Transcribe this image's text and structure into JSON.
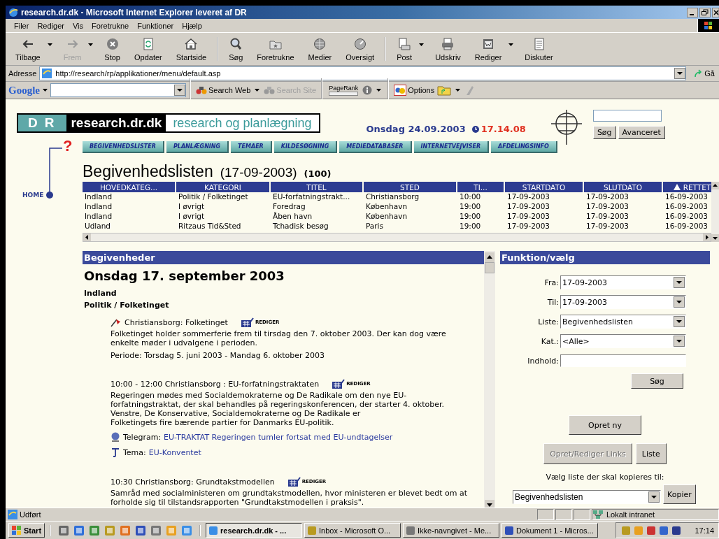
{
  "window": {
    "title": "research.dr.dk - Microsoft Internet Explorer leveret af DR"
  },
  "menu": [
    "Filer",
    "Rediger",
    "Vis",
    "Foretrukne",
    "Funktioner",
    "Hjælp"
  ],
  "toolbar": [
    {
      "label": "Tilbage",
      "disabled": false,
      "dropdown": true,
      "separator_before": false
    },
    {
      "label": "Frem",
      "disabled": true,
      "dropdown": true,
      "separator_before": false
    },
    {
      "label": "Stop",
      "disabled": false,
      "dropdown": false,
      "separator_before": false
    },
    {
      "label": "Opdater",
      "disabled": false,
      "dropdown": false,
      "separator_before": false
    },
    {
      "label": "Startside",
      "disabled": false,
      "dropdown": false,
      "separator_before": false
    },
    {
      "label": "Søg",
      "disabled": false,
      "dropdown": false,
      "separator_before": true
    },
    {
      "label": "Foretrukne",
      "disabled": false,
      "dropdown": false,
      "separator_before": false
    },
    {
      "label": "Medier",
      "disabled": false,
      "dropdown": false,
      "separator_before": false
    },
    {
      "label": "Oversigt",
      "disabled": false,
      "dropdown": false,
      "separator_before": false
    },
    {
      "label": "Post",
      "disabled": false,
      "dropdown": true,
      "separator_before": true
    },
    {
      "label": "Udskriv",
      "disabled": false,
      "dropdown": false,
      "separator_before": false
    },
    {
      "label": "Rediger",
      "disabled": false,
      "dropdown": true,
      "separator_before": false
    },
    {
      "label": "Diskuter",
      "disabled": false,
      "dropdown": false,
      "separator_before": false
    }
  ],
  "address": {
    "label": "Adresse",
    "url": "http://research/rp/applikationer/menu/default.asp",
    "go": "Gå"
  },
  "google_bar": {
    "logo": "Google",
    "search_web": "Search Web",
    "search_site": "Search Site",
    "pagerank": "PageRank",
    "options": "Options"
  },
  "site": {
    "logo_mark": "DR",
    "site_name": "research.dr.dk",
    "tagline": "research og planlægning",
    "date": "Onsdag 24.09.2003",
    "time": "17.14.08",
    "search_button": "Søg",
    "advanced_button": "Avanceret",
    "help_mark": "?",
    "home_link": "HOME"
  },
  "nav": [
    "BEGIVENHEDSLISTER",
    "PLANLÆGNING",
    "TEMAER",
    "KILDESØGNING",
    "MEDIEDATABASER",
    "INTERNETVEJVISER",
    "AFDELINGSINFO"
  ],
  "list": {
    "title": "Begivenhedslisten",
    "range": "(17-09-2003)",
    "count": "(100)",
    "columns": [
      {
        "label": "HOVEDKATEG...",
        "sorted": false
      },
      {
        "label": "KATEGORI",
        "sorted": false
      },
      {
        "label": "TITEL",
        "sorted": false
      },
      {
        "label": "STED",
        "sorted": false
      },
      {
        "label": "TI...",
        "sorted": false
      },
      {
        "label": "STARTDATO",
        "sorted": false
      },
      {
        "label": "SLUTDATO",
        "sorted": false
      },
      {
        "label": "RETTET",
        "sorted": true
      }
    ],
    "rows": [
      [
        "Indland",
        "Politik / Folketinget",
        "EU-forfatningstrakt...",
        "Christiansborg",
        "10:00",
        "17-09-2003",
        "17-09-2003",
        "16-09-2003"
      ],
      [
        "Indland",
        "I øvrigt",
        "Foredrag",
        "København",
        "19:00",
        "17-09-2003",
        "17-09-2003",
        "16-09-2003"
      ],
      [
        "Indland",
        "I øvrigt",
        "Åben havn",
        "København",
        "19:00",
        "17-09-2003",
        "17-09-2003",
        "16-09-2003"
      ],
      [
        "Udland",
        "Ritzaus Tid&Sted",
        "Tchadisk besøg",
        "Paris",
        "19:00",
        "17-09-2003",
        "17-09-2003",
        "16-09-2003"
      ]
    ]
  },
  "events_panel": {
    "title": "Begivenheder",
    "date_heading": "Onsdag 17. september 2003",
    "category": "Indland",
    "subcategory": "Politik / Folketinget",
    "items": [
      {
        "kind": "flagged",
        "heading": "Christiansborg: Folketinget",
        "edit": "REDIGER",
        "body": "Folketinget holder sommerferie frem til tirsdag den 7. oktober 2003. Der kan dog være\nenkelte møder i udvalgene i perioden.",
        "period": "Periode: Torsdag 5. juni 2003 - Mandag 6. oktober 2003"
      },
      {
        "kind": "plain",
        "heading": "10:00 - 12:00 Christiansborg : EU-forfatningstraktaten",
        "edit": "REDIGER",
        "body": "Regeringen mødes med Socialdemokraterne og De Radikale om den nye EU-\nforfatningstraktat, der skal behandles på regeringskonferencen, der starter 4. oktober.\nVenstre, De Konservative, Socialdemokraterne og De Radikale er\nFolketingets fire bærende partier for Danmarks EU-politik.",
        "links": [
          {
            "kind": "telegram",
            "label": "Telegram:",
            "link": "EU-TRAKTAT Regeringen tumler fortsat med EU-undtagelser"
          },
          {
            "kind": "theme",
            "label": "Tema:",
            "link": "EU-Konventet"
          }
        ]
      },
      {
        "kind": "plain",
        "heading": "10:30 Christiansborg: Grundtakstmodellen",
        "edit": "REDIGER",
        "body": "Samråd med socialministeren om grundtakstmodellen, hvor ministeren er blevet bedt om at\nforholde sig til tilstandsrapporten \"Grundtakstmodellen i praksis\"."
      }
    ]
  },
  "function_panel": {
    "title": "Funktion/vælg",
    "fields": [
      {
        "kind": "select",
        "label": "Fra:",
        "value": "17-09-2003"
      },
      {
        "kind": "select",
        "label": "Til:",
        "value": "17-09-2003"
      },
      {
        "kind": "select",
        "label": "Liste:",
        "value": "Begivenhedslisten"
      },
      {
        "kind": "select",
        "label": "Kat.:",
        "value": "<Alle>"
      },
      {
        "kind": "text",
        "label": "Indhold:"
      }
    ],
    "search_button": "Søg",
    "create_button": "Opret ny",
    "links_button": {
      "label": "Opret/Rediger Links",
      "disabled": true
    },
    "list_button": "Liste",
    "copy_label": "Vælg liste der skal kopieres til:",
    "copy_select": "Begivenhedslisten",
    "copy_button": "Kopier"
  },
  "status_bar": {
    "text": "Udført",
    "zone": "Lokalt intranet"
  },
  "taskbar": {
    "start": "Start",
    "tasks": [
      {
        "label": "research.dr.dk - ...",
        "selected": true
      },
      {
        "label": "Inbox - Microsoft O...",
        "selected": false
      },
      {
        "label": "Ikke-navngivet - Me...",
        "selected": false
      },
      {
        "label": "Dokument 1 - Micros...",
        "selected": false
      }
    ],
    "clock": "17:14"
  }
}
